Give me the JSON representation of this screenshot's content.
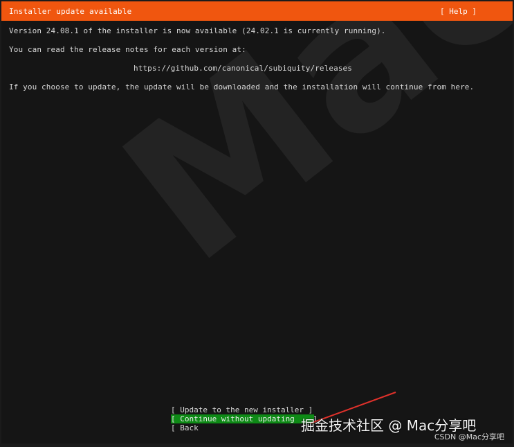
{
  "header": {
    "title": "Installer update available",
    "help_label": "[ Help ]"
  },
  "body": {
    "version_line": "Version 24.08.1 of the installer is now available (24.02.1 is currently running).",
    "notes_line": "You can read the release notes for each version at:",
    "release_url": "https://github.com/canonical/subiquity/releases",
    "choice_line": "If you choose to update, the update will be downloaded and the installation will continue from here."
  },
  "menu": {
    "options": [
      {
        "label": "[ Update to the new installer ]",
        "selected": false
      },
      {
        "label": "[ Continue without updating    ]",
        "selected": true
      },
      {
        "label": "[ Back",
        "selected": false
      }
    ]
  },
  "overlay": {
    "watermark_text": "Mac分享",
    "juejin_credit": "掘金技术社区 @ Mac分享吧",
    "csdn_credit": "CSDN @Mac分享吧"
  },
  "colors": {
    "header_bg": "#f0560f",
    "selected_bg": "#0e8a16",
    "annotation_arrow": "#e0312b"
  }
}
